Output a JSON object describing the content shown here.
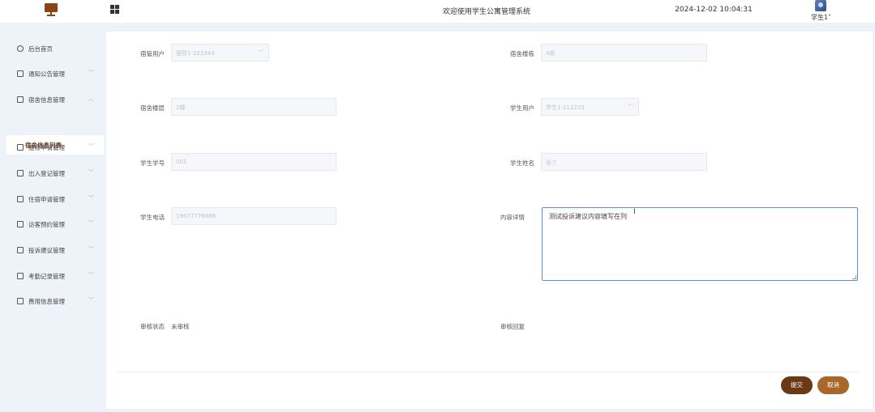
{
  "header": {
    "welcome": "欢迎使用学生公寓管理系统",
    "datetime": "2024-12-02 10:04:31",
    "user": "学生1˅"
  },
  "sidebar": {
    "items": [
      {
        "label": "后台首页",
        "icon": "clock-icon"
      },
      {
        "label": "通知公告管理",
        "icon": "list-icon"
      },
      {
        "label": "宿舍信息管理",
        "icon": "list-icon",
        "expanded": true
      },
      {
        "label": "维修申请管理",
        "icon": "list-icon"
      },
      {
        "label": "出入登记管理",
        "icon": "list-icon"
      },
      {
        "label": "住宿申请管理",
        "icon": "list-icon"
      },
      {
        "label": "访客预约管理",
        "icon": "list-icon"
      },
      {
        "label": "投诉建议管理",
        "icon": "list-icon"
      },
      {
        "label": "考勤记录管理",
        "icon": "list-icon"
      },
      {
        "label": "费用信息管理",
        "icon": "list-icon"
      }
    ],
    "active_sub": "宿舍信息列表"
  },
  "form": {
    "dorm_user_label": "宿管用户",
    "dorm_user_value": "宿管1-223344",
    "dorm_building_label": "宿舍楼栋",
    "dorm_building_placeholder": "A栋",
    "dorm_floor_label": "宿舍楼层",
    "dorm_floor_placeholder": "2楼",
    "student_user_label": "学生用户",
    "student_user_value": "学生1-112233",
    "student_id_label": "学生学号",
    "student_id_placeholder": "001",
    "student_name_label": "学生姓名",
    "student_name_placeholder": "张三",
    "student_phone_label": "学生电话",
    "student_phone_placeholder": "18677778888",
    "content_label": "内容详情",
    "content_value": "测试投诉建议内容填写在列",
    "review_status_label": "审核状态",
    "review_status_value": "未审核",
    "review_reply_label": "审核回复"
  },
  "buttons": {
    "submit": "提交",
    "cancel": "取消"
  },
  "colors": {
    "brand": "#6b3a14",
    "cancel": "#a9672a",
    "focus_border": "#5b8fd6"
  }
}
